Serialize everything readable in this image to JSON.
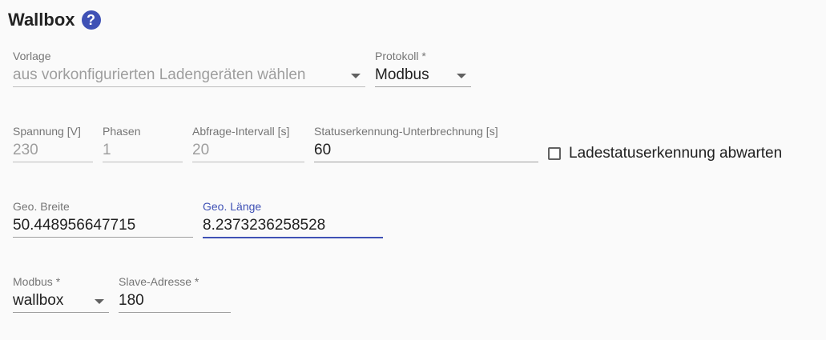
{
  "section": {
    "title": "Wallbox",
    "help_icon": "?"
  },
  "fields": {
    "vorlage": {
      "label": "Vorlage",
      "value": "aus vorkonfigurierten Ladengeräten wählen"
    },
    "protokoll": {
      "label": "Protokoll *",
      "value": "Modbus"
    },
    "spannung": {
      "label": "Spannung [V]",
      "value": "230"
    },
    "phasen": {
      "label": "Phasen",
      "value": "1"
    },
    "abfrage": {
      "label": "Abfrage-Intervall [s]",
      "value": "20"
    },
    "statuserkennung": {
      "label": "Statuserkennung-Unterbrechnung [s]",
      "value": "60"
    },
    "geo_breite": {
      "label": "Geo. Breite",
      "value": "50.448956647715"
    },
    "geo_laenge": {
      "label": "Geo. Länge",
      "value": "8.2373236258528"
    },
    "modbus": {
      "label": "Modbus *",
      "value": "wallbox"
    },
    "slave_adresse": {
      "label": "Slave-Adresse *",
      "value": "180"
    }
  },
  "checkbox": {
    "label": "Ladestatuserkennung abwarten",
    "checked": false
  },
  "colors": {
    "accent": "#3f51b5",
    "background": "#fafafa"
  }
}
